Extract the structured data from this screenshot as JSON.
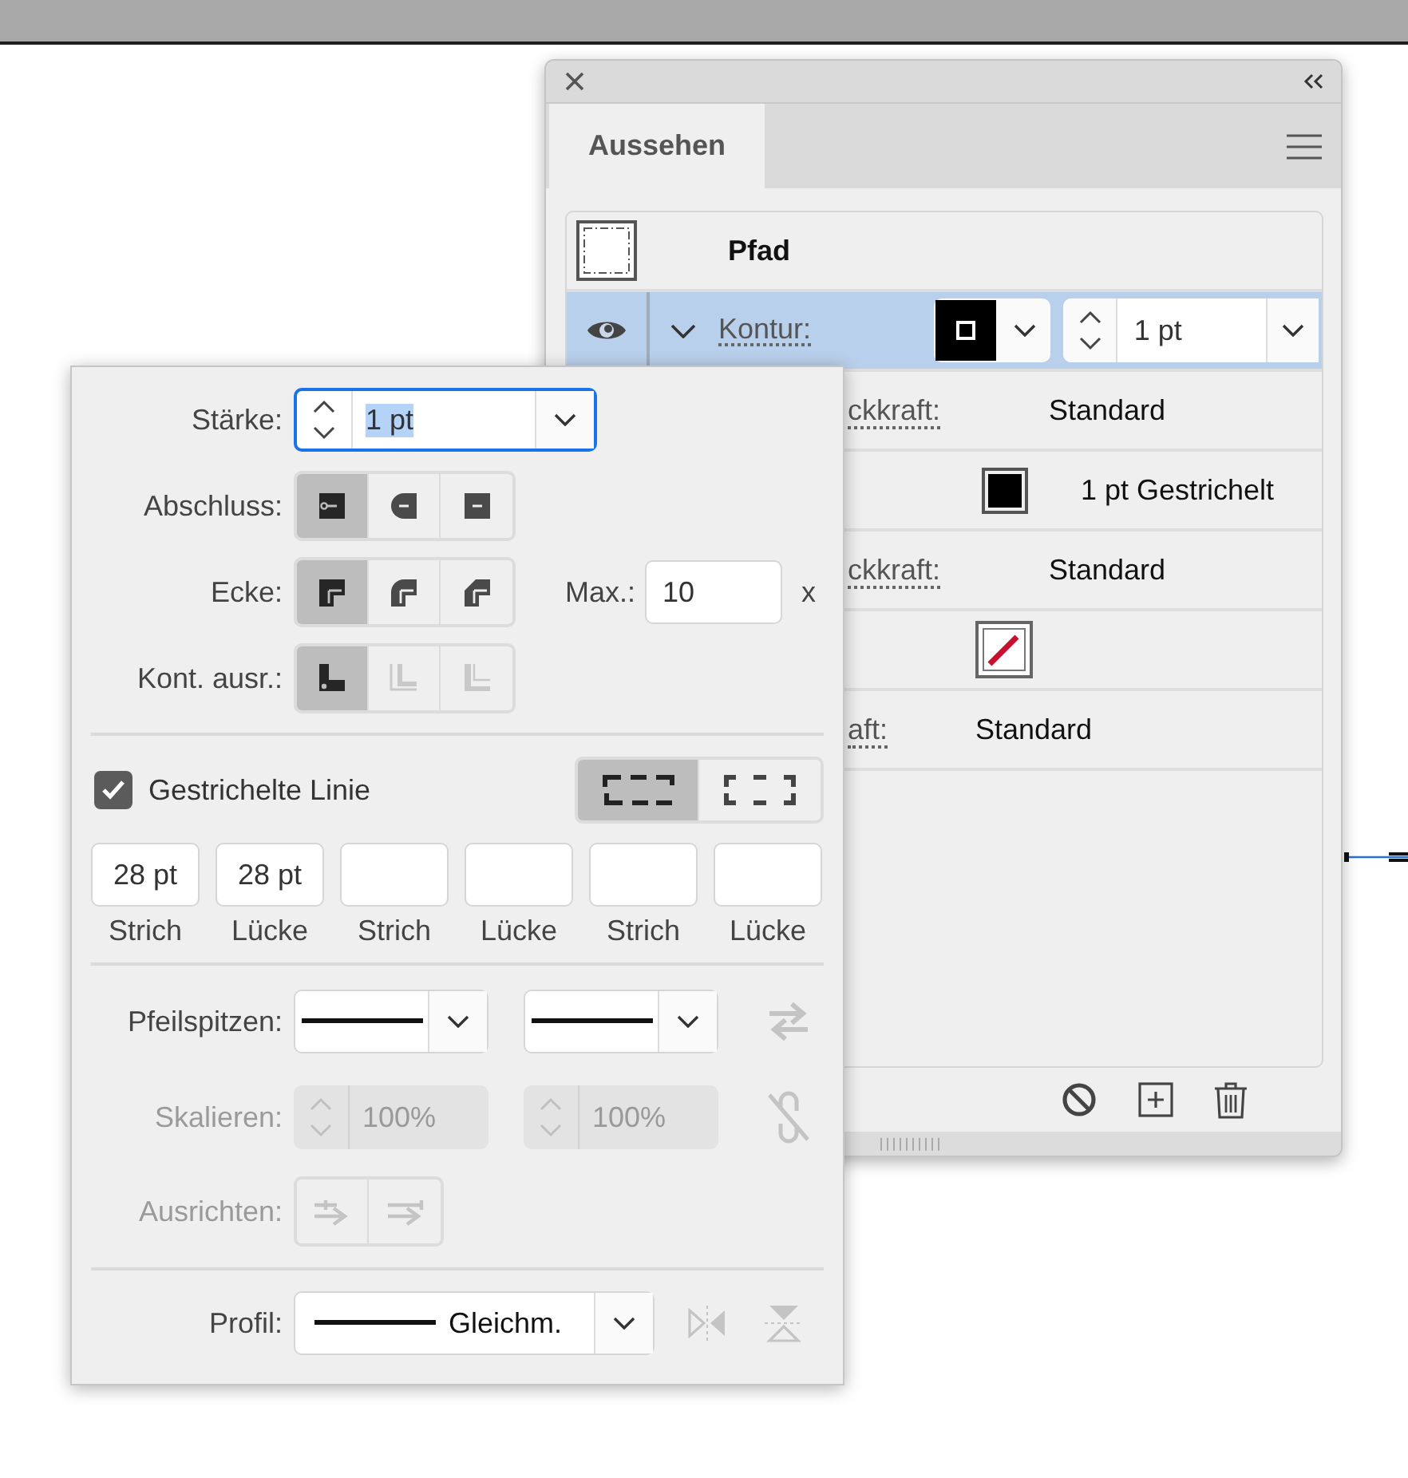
{
  "appearance_panel": {
    "tabs": [
      {
        "label": "Aussehen",
        "selected": true
      }
    ],
    "header": {
      "label": "Pfad"
    },
    "rows": [
      {
        "kind": "stroke",
        "selected": true,
        "visible": true,
        "expanded": true,
        "label": "Kontur:",
        "color": "#000000",
        "weight": "1 pt"
      },
      {
        "kind": "opacity",
        "selected": false,
        "label": "ckkraft:",
        "value": "Standard"
      },
      {
        "kind": "dash",
        "selected": false,
        "color": "#000000",
        "value": "1 pt Gestrichelt"
      },
      {
        "kind": "opacity",
        "selected": false,
        "label": "ckkraft:",
        "value": "Standard"
      },
      {
        "kind": "fill-none",
        "selected": false
      },
      {
        "kind": "object-opacity",
        "selected": false,
        "label": "aft:",
        "value": "Standard"
      }
    ]
  },
  "stroke_options": {
    "weight": {
      "label": "Stärke:",
      "value": "1 pt"
    },
    "cap": {
      "label": "Abschluss:",
      "options": [
        {
          "kind": "butt",
          "selected": true
        },
        {
          "kind": "round",
          "selected": false
        },
        {
          "kind": "projecting",
          "selected": false
        }
      ]
    },
    "corner": {
      "label": "Ecke:",
      "options": [
        {
          "kind": "miter",
          "selected": true
        },
        {
          "kind": "round",
          "selected": false
        },
        {
          "kind": "bevel",
          "selected": false
        }
      ],
      "limit_label": "Max.:",
      "limit": "10",
      "limit_unit": "x"
    },
    "align": {
      "label": "Kont. ausr.:",
      "options": [
        {
          "kind": "center",
          "selected": true,
          "disabled": false
        },
        {
          "kind": "inside",
          "selected": false,
          "disabled": true
        },
        {
          "kind": "outside",
          "selected": false,
          "disabled": true
        }
      ]
    },
    "dashed": {
      "label": "Gestrichelte Linie",
      "checked": true,
      "modes": [
        {
          "kind": "preserve",
          "selected": true
        },
        {
          "kind": "align",
          "selected": false
        }
      ],
      "segments": [
        {
          "label": "Strich",
          "value": "28 pt"
        },
        {
          "label": "Lücke",
          "value": "28 pt"
        },
        {
          "label": "Strich"
        },
        {
          "label": "Lücke"
        },
        {
          "label": "Strich"
        },
        {
          "label": "Lücke"
        }
      ]
    },
    "arrowheads": {
      "label": "Pfeilspitzen:"
    },
    "scale": {
      "label": "Skalieren:",
      "disabled": true,
      "start": "100%",
      "end": "100%"
    },
    "arrow_align": {
      "label": "Ausrichten:",
      "disabled": true
    },
    "profile": {
      "label": "Profil:",
      "value": "Gleichm."
    }
  }
}
